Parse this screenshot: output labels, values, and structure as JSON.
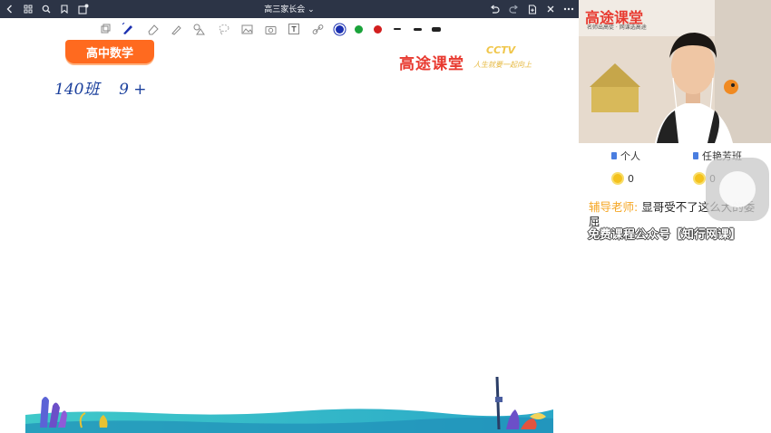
{
  "window": {
    "title": "高三家长会",
    "title_suffix": "⌄"
  },
  "titlebar": {
    "left_icons": [
      "back-icon",
      "grid-icon",
      "search-icon",
      "bookmark-icon",
      "share-icon"
    ],
    "right_icons": [
      "undo-icon",
      "redo-icon",
      "add-page-icon",
      "close-icon",
      "more-icon"
    ]
  },
  "toolbar": {
    "tools": [
      "select-icon",
      "pen-icon",
      "eraser-icon",
      "marker-icon",
      "shapes-icon",
      "lasso-icon",
      "image-icon",
      "camera-icon",
      "text-icon",
      "link-icon"
    ],
    "colors": [
      "#1a2fb0",
      "#1aa33a",
      "#d21e1e"
    ],
    "stroke_sizes": [
      "thin",
      "medium",
      "thick"
    ]
  },
  "board": {
    "subject_badge": "高中数学",
    "brand_logo": "高途课堂",
    "cctv_logo": "CCTV",
    "cctv_tagline": "人生就要一起向上",
    "handwriting": "140班    9 +"
  },
  "video": {
    "brand": "高途课堂",
    "slogan": "名师出高徒 · 网课选高途"
  },
  "panel": {
    "tabs": [
      {
        "label": "个人"
      },
      {
        "label": "任艳芳班"
      }
    ],
    "scores": [
      {
        "value": "0"
      },
      {
        "value": "0"
      }
    ],
    "chat": {
      "sender": "辅导老师:",
      "message": "显哥受不了这么大的委屈"
    },
    "watermark": "免费课程公众号【知行网课】"
  },
  "colors": {
    "titlebar": "#2c3446",
    "accent_orange": "#ff6a1f",
    "brand_red": "#e8392f",
    "sender_orange": "#f5a623",
    "ink_blue": "#1a3f9c"
  }
}
